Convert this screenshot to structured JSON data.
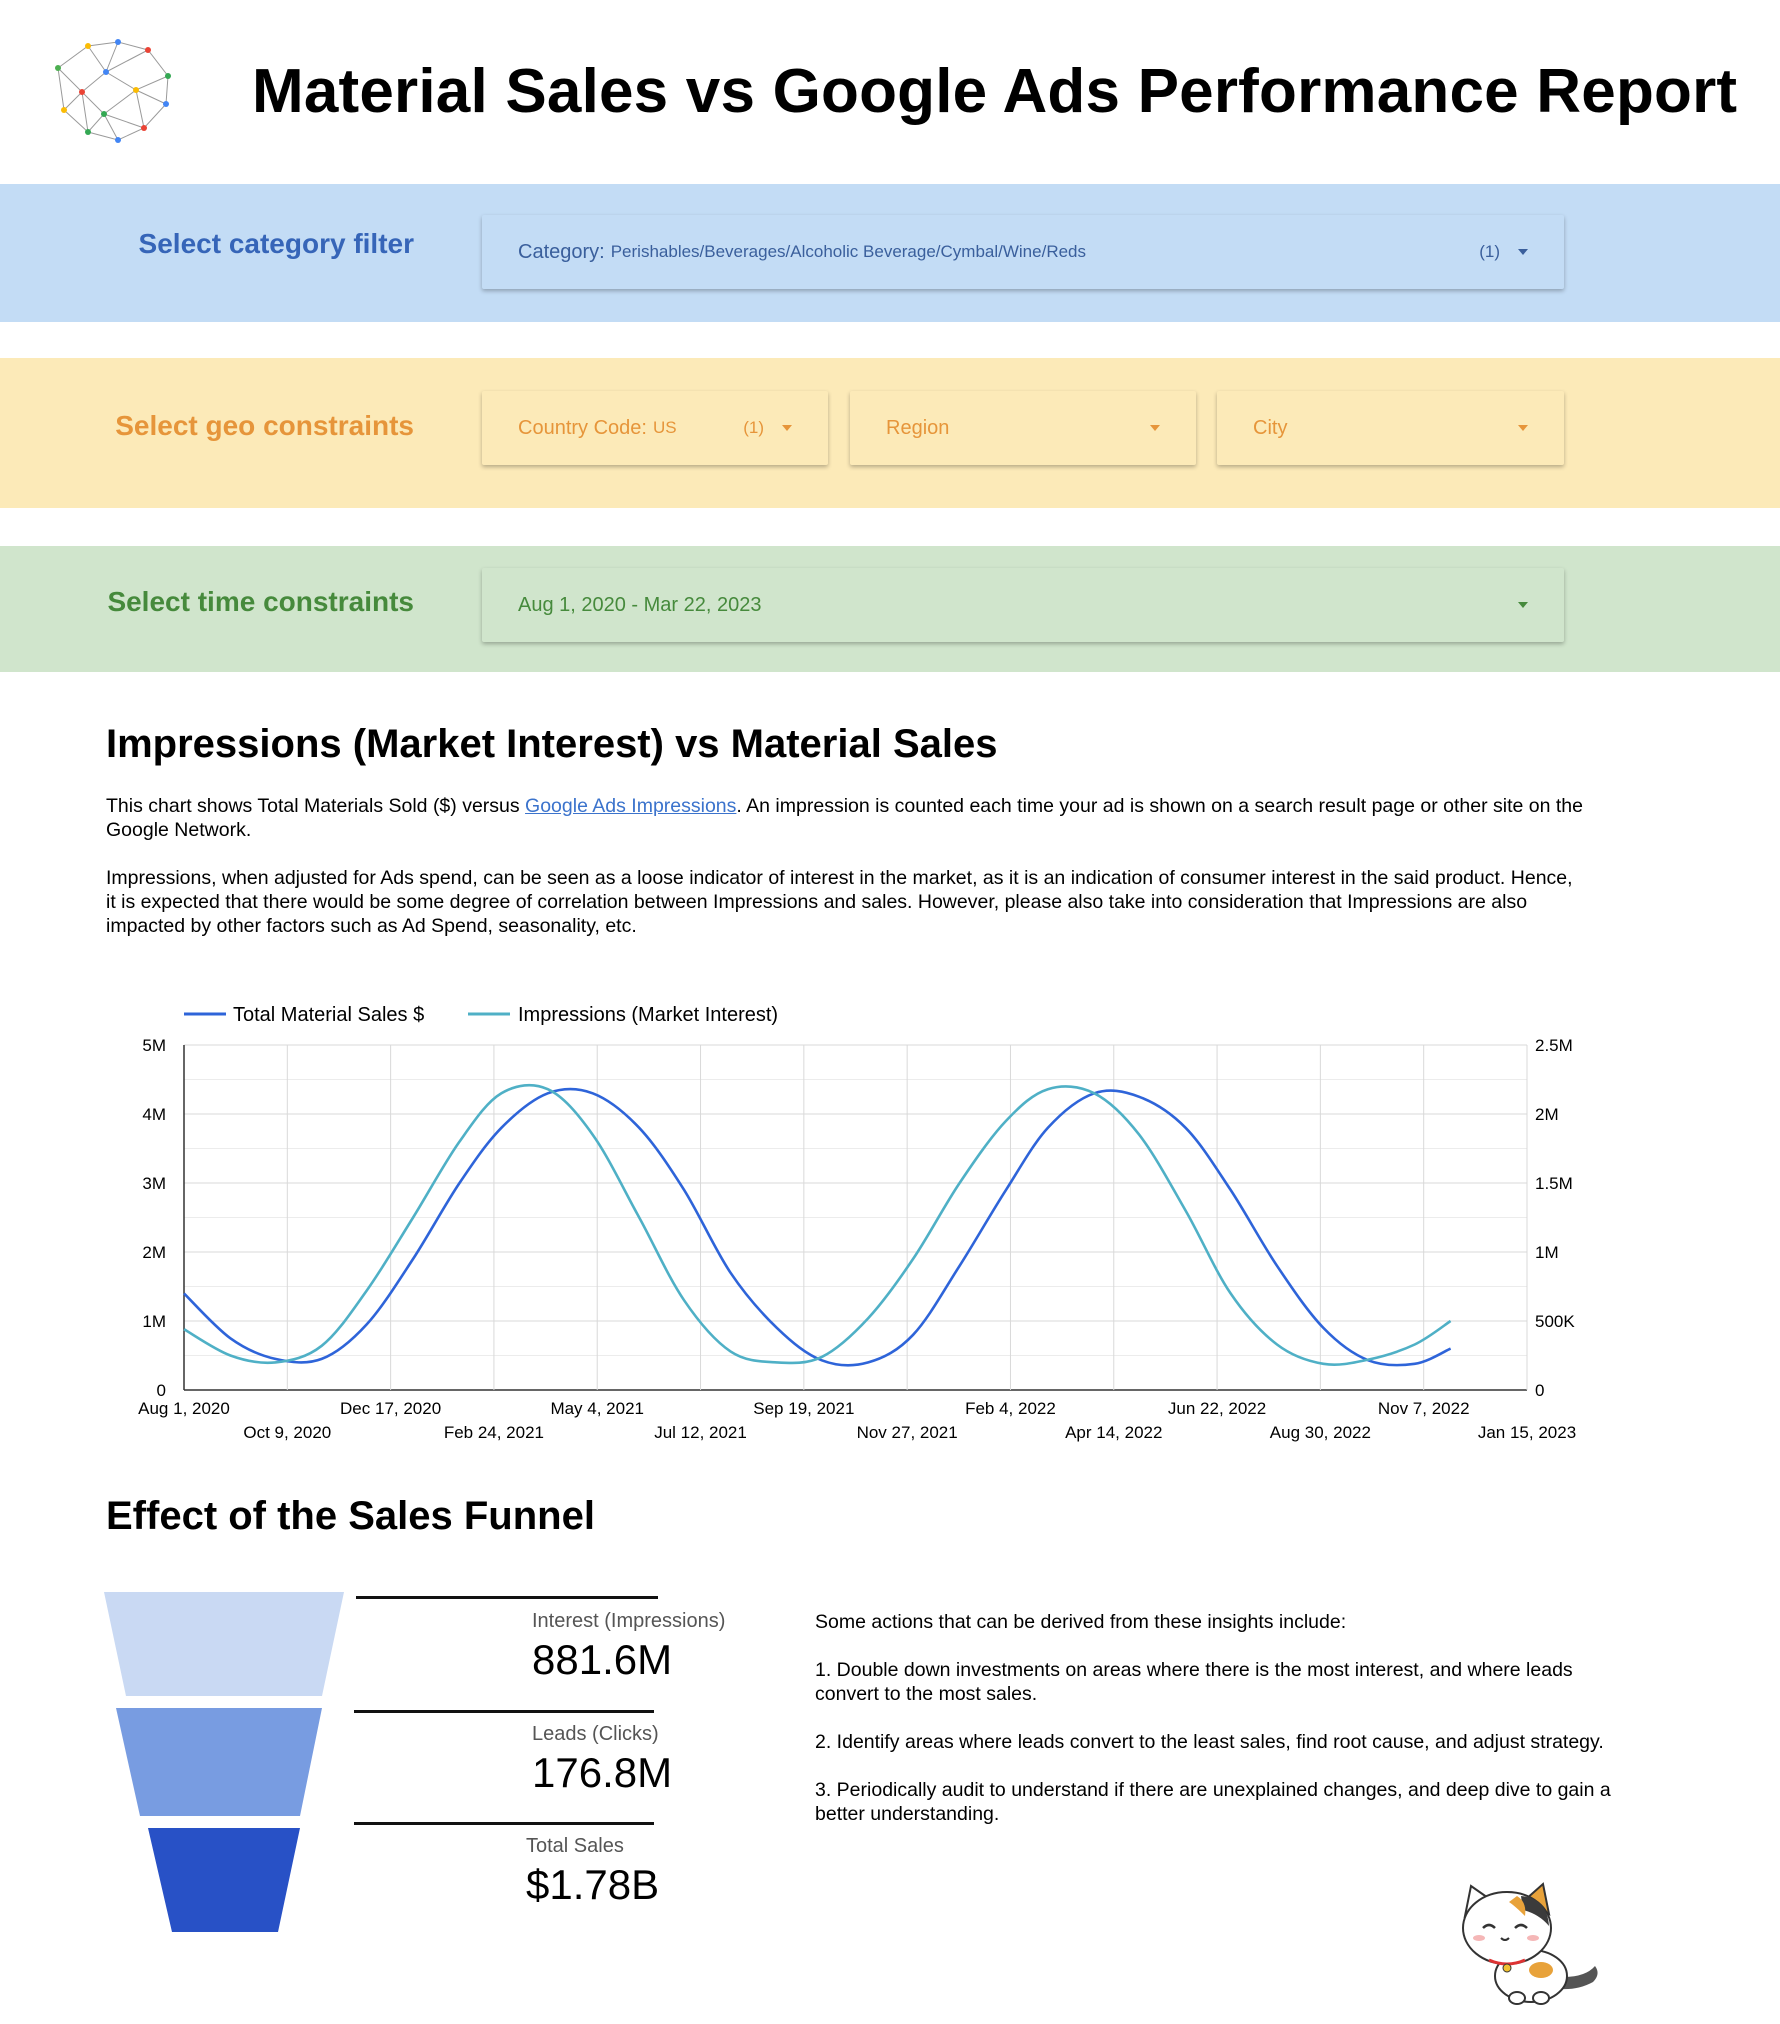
{
  "header": {
    "title": "Material Sales vs Google Ads Performance Report",
    "logo_icon": "network-brain-icon"
  },
  "filters": {
    "category": {
      "label": "Select category filter",
      "dropdown_name": "Category",
      "dropdown_value": "Perishables/Beverages/Alcoholic Beverage/Cymbal/Wine/Reds",
      "count": "(1)"
    },
    "geo": {
      "label": "Select geo constraints",
      "country": {
        "name": "Country Code",
        "value": "US",
        "count": "(1)"
      },
      "region": {
        "name": "Region"
      },
      "city": {
        "name": "City"
      }
    },
    "time": {
      "label": "Select time constraints",
      "value": "Aug 1, 2020 - Mar 22, 2023"
    }
  },
  "impressions_section": {
    "title": "Impressions (Market Interest) vs Material Sales",
    "para1_prefix": "This chart shows Total Materials Sold ($) versus ",
    "para1_link": "Google Ads Impressions",
    "para1_suffix": ". An impression is counted each time your ad is shown on a search result page or other site on the Google Network.",
    "para2": "Impressions, when adjusted for Ads spend, can be seen as a loose indicator of interest in the market, as it is an indication of consumer interest in the said product. Hence, it is expected that there would be some degree of correlation between Impressions and sales. However, please also take into consideration that Impressions are also impacted by other factors such as Ad Spend, seasonality, etc."
  },
  "chart_data": {
    "type": "line",
    "legend_position": "top-left",
    "grid": true,
    "series": [
      {
        "name": "Total Material Sales $",
        "axis": "left",
        "color": "#2e64d9",
        "x": [
          "2020-08-01",
          "2020-09-01",
          "2020-10-01",
          "2020-11-01",
          "2020-12-01",
          "2021-01-01",
          "2021-02-01",
          "2021-03-01",
          "2021-04-01",
          "2021-05-01",
          "2021-06-01",
          "2021-07-01",
          "2021-08-01",
          "2021-09-01",
          "2021-10-01",
          "2021-11-01",
          "2021-12-01",
          "2022-01-01",
          "2022-02-01",
          "2022-03-01",
          "2022-04-01",
          "2022-05-01",
          "2022-06-01",
          "2022-07-01",
          "2022-08-01",
          "2022-09-01",
          "2022-10-01",
          "2022-11-01",
          "2022-11-25"
        ],
        "values": [
          1400000,
          750000,
          450000,
          450000,
          950000,
          1900000,
          3000000,
          3800000,
          4300000,
          4300000,
          3800000,
          2900000,
          1700000,
          900000,
          430000,
          400000,
          800000,
          1800000,
          2900000,
          3800000,
          4300000,
          4250000,
          3800000,
          2900000,
          1800000,
          900000,
          430000,
          380000,
          600000
        ]
      },
      {
        "name": "Impressions (Market Interest)",
        "axis": "right",
        "color": "#4fb0c6",
        "x": [
          "2020-08-01",
          "2020-09-01",
          "2020-10-01",
          "2020-11-01",
          "2020-12-01",
          "2021-01-01",
          "2021-02-01",
          "2021-03-01",
          "2021-04-01",
          "2021-05-01",
          "2021-06-01",
          "2021-07-01",
          "2021-08-01",
          "2021-09-01",
          "2021-10-01",
          "2021-11-01",
          "2021-12-01",
          "2022-01-01",
          "2022-02-01",
          "2022-03-01",
          "2022-04-01",
          "2022-05-01",
          "2022-06-01",
          "2022-07-01",
          "2022-08-01",
          "2022-09-01",
          "2022-10-01",
          "2022-11-01",
          "2022-11-25"
        ],
        "values": [
          440000,
          250000,
          200000,
          320000,
          720000,
          1250000,
          1800000,
          2150000,
          2180000,
          1850000,
          1250000,
          650000,
          280000,
          200000,
          240000,
          520000,
          950000,
          1500000,
          1950000,
          2180000,
          2150000,
          1850000,
          1300000,
          700000,
          330000,
          190000,
          220000,
          330000,
          500000
        ]
      }
    ],
    "y_left": {
      "ticks": [
        "0",
        "1M",
        "2M",
        "3M",
        "4M",
        "5M"
      ],
      "range": [
        0,
        5000000
      ]
    },
    "y_right": {
      "ticks": [
        "0",
        "500K",
        "1M",
        "1.5M",
        "2M",
        "2.5M"
      ],
      "range": [
        0,
        2500000
      ]
    },
    "x_range": [
      "2020-08-01",
      "2023-01-15"
    ],
    "x_ticks": [
      {
        "date": "2020-08-01",
        "label": "Aug 1, 2020"
      },
      {
        "date": "2020-10-09",
        "label": "Oct 9, 2020"
      },
      {
        "date": "2020-12-17",
        "label": "Dec 17, 2020"
      },
      {
        "date": "2021-02-24",
        "label": "Feb 24, 2021"
      },
      {
        "date": "2021-05-04",
        "label": "May 4, 2021"
      },
      {
        "date": "2021-07-12",
        "label": "Jul 12, 2021"
      },
      {
        "date": "2021-09-19",
        "label": "Sep 19, 2021"
      },
      {
        "date": "2021-11-27",
        "label": "Nov 27, 2021"
      },
      {
        "date": "2022-02-04",
        "label": "Feb 4, 2022"
      },
      {
        "date": "2022-04-14",
        "label": "Apr 14, 2022"
      },
      {
        "date": "2022-06-22",
        "label": "Jun 22, 2022"
      },
      {
        "date": "2022-08-30",
        "label": "Aug 30, 2022"
      },
      {
        "date": "2022-11-07",
        "label": "Nov 7, 2022"
      },
      {
        "date": "2023-01-15",
        "label": "Jan 15, 2023"
      }
    ]
  },
  "funnel_section": {
    "title": "Effect of the Sales Funnel",
    "stages": [
      {
        "label": "Interest (Impressions)",
        "value": "881.6M",
        "color": "#c9d9f3"
      },
      {
        "label": "Leads (Clicks)",
        "value": "176.8M",
        "color": "#789ce1"
      },
      {
        "label": "Total Sales",
        "value": "$1.78B",
        "color": "#2851c6"
      }
    ],
    "insights": [
      "Some actions that can be derived from these insights include:",
      "1. Double down investments on areas where there is the most interest, and where leads convert to the most sales.",
      "2. Identify areas where leads convert to the least sales, find root cause, and adjust strategy.",
      "3. Periodically audit to understand if there are unexplained changes, and deep dive to gain a better understanding."
    ]
  },
  "mascot_icon": "cat-mascot-icon"
}
